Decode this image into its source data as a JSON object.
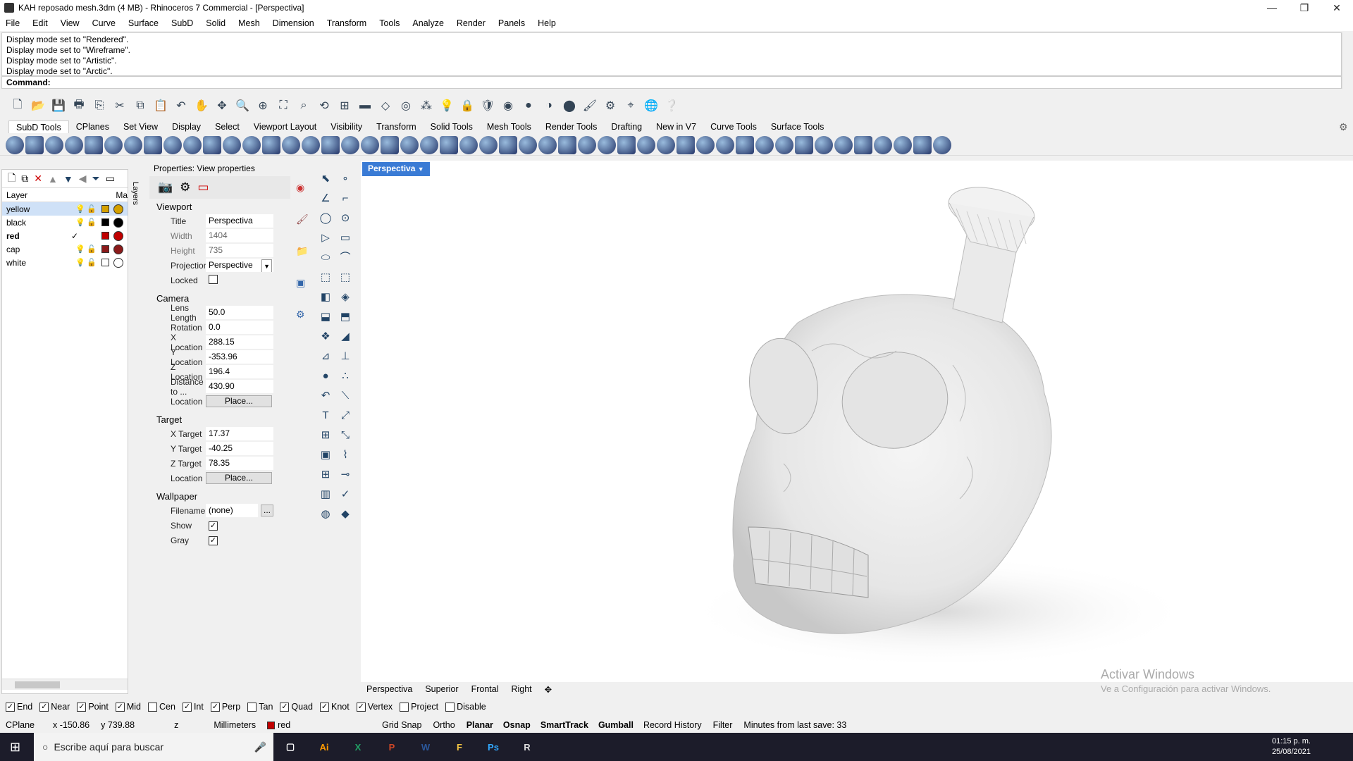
{
  "window": {
    "title": "KAH reposado mesh.3dm (4 MB) - Rhinoceros 7 Commercial - [Perspectiva]"
  },
  "menu": [
    "File",
    "Edit",
    "View",
    "Curve",
    "Surface",
    "SubD",
    "Solid",
    "Mesh",
    "Dimension",
    "Transform",
    "Tools",
    "Analyze",
    "Render",
    "Panels",
    "Help"
  ],
  "command_history": [
    "Display mode set to \"Rendered\".",
    "Display mode set to \"Wireframe\".",
    "Display mode set to \"Artistic\".",
    "Display mode set to \"Arctic\"."
  ],
  "command_prompt": "Command:",
  "toolbar_tabs": [
    "SubD Tools",
    "CPlanes",
    "Set View",
    "Display",
    "Select",
    "Viewport Layout",
    "Visibility",
    "Transform",
    "Solid Tools",
    "Mesh Tools",
    "Render Tools",
    "Drafting",
    "New in V7",
    "Curve Tools",
    "Surface Tools"
  ],
  "layers": {
    "header_layer": "Layer",
    "header_material": "Ma",
    "side_tab": "Layers",
    "rows": [
      {
        "name": "yellow",
        "color": "#d4a000",
        "selected": true,
        "current": false
      },
      {
        "name": "black",
        "color": "#000000",
        "selected": false,
        "current": false
      },
      {
        "name": "red",
        "color": "#c00000",
        "selected": false,
        "current": true
      },
      {
        "name": "cap",
        "color": "#8b1a1a",
        "selected": false,
        "current": false
      },
      {
        "name": "white",
        "color": "#ffffff",
        "selected": false,
        "current": false
      }
    ]
  },
  "properties": {
    "title": "Properties: View properties",
    "viewport": {
      "section": "Viewport",
      "title_label": "Title",
      "title": "Perspectiva",
      "width_label": "Width",
      "width": "1404",
      "height_label": "Height",
      "height": "735",
      "projection_label": "Projection",
      "projection": "Perspective",
      "locked_label": "Locked"
    },
    "camera": {
      "section": "Camera",
      "lens_label": "Lens Length",
      "lens": "50.0",
      "rotation_label": "Rotation",
      "rotation": "0.0",
      "x_label": "X Location",
      "x": "288.15",
      "y_label": "Y Location",
      "y": "-353.96",
      "z_label": "Z Location",
      "z": "196.4",
      "dist_label": "Distance to ...",
      "dist": "430.90",
      "loc_label": "Location",
      "place": "Place..."
    },
    "target": {
      "section": "Target",
      "x_label": "X Target",
      "x": "17.37",
      "y_label": "Y Target",
      "y": "-40.25",
      "z_label": "Z Target",
      "z": "78.35",
      "loc_label": "Location",
      "place": "Place..."
    },
    "wallpaper": {
      "section": "Wallpaper",
      "filename_label": "Filename",
      "filename": "(none)",
      "browse": "...",
      "show_label": "Show",
      "gray_label": "Gray"
    }
  },
  "viewport": {
    "active_tab": "Perspectiva",
    "tabs": [
      "Perspectiva",
      "Superior",
      "Frontal",
      "Right"
    ],
    "watermark_title": "Activar Windows",
    "watermark_sub": "Ve a Configuración para activar Windows."
  },
  "osnaps": [
    {
      "label": "End",
      "checked": true
    },
    {
      "label": "Near",
      "checked": true
    },
    {
      "label": "Point",
      "checked": true
    },
    {
      "label": "Mid",
      "checked": true
    },
    {
      "label": "Cen",
      "checked": false
    },
    {
      "label": "Int",
      "checked": true
    },
    {
      "label": "Perp",
      "checked": true
    },
    {
      "label": "Tan",
      "checked": false
    },
    {
      "label": "Quad",
      "checked": true
    },
    {
      "label": "Knot",
      "checked": true
    },
    {
      "label": "Vertex",
      "checked": true
    },
    {
      "label": "Project",
      "checked": false
    },
    {
      "label": "Disable",
      "checked": false
    }
  ],
  "status": {
    "cplane": "CPlane",
    "x": "x -150.86",
    "y": "y 739.88",
    "z": "z",
    "units": "Millimeters",
    "layer": "red",
    "grid_snap": "Grid Snap",
    "ortho": "Ortho",
    "planar": "Planar",
    "osnap": "Osnap",
    "smarttrack": "SmartTrack",
    "gumball": "Gumball",
    "record_history": "Record History",
    "filter": "Filter",
    "save_info": "Minutes from last save: 33"
  },
  "taskbar": {
    "search_placeholder": "Escribe aquí para buscar",
    "time": "01:15 p. m.",
    "date": "25/08/2021",
    "apps": [
      {
        "name": "Ai",
        "color": "#ff9a00"
      },
      {
        "name": "X",
        "color": "#21a366"
      },
      {
        "name": "P",
        "color": "#d24726"
      },
      {
        "name": "W",
        "color": "#2b579a"
      },
      {
        "name": "F",
        "color": "#f4c542"
      },
      {
        "name": "Ps",
        "color": "#31a8ff"
      },
      {
        "name": "R",
        "color": "#dddddd"
      }
    ]
  }
}
